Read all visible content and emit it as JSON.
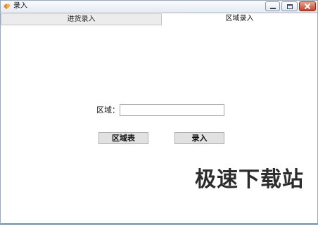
{
  "window": {
    "title": "录入",
    "controls": {
      "minimize_icon": "minimize-icon",
      "maximize_icon": "maximize-icon",
      "close_icon": "close-icon"
    }
  },
  "tabs": [
    {
      "label": "进货录入",
      "active": false
    },
    {
      "label": "区域录入",
      "active": true
    }
  ],
  "form": {
    "region_label": "区域：",
    "region_value": "",
    "buttons": {
      "region_table": "区域表",
      "enter": "录入"
    }
  },
  "watermark": "极速下载站",
  "colors": {
    "close_button": "#c8412a",
    "tab_inactive_bg": "#ececec",
    "button_bg": "#e1e1e1"
  }
}
